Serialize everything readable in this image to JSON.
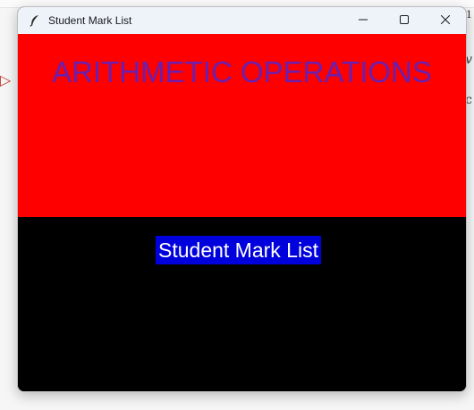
{
  "window": {
    "title": "Student Mark List",
    "icon": "feather-icon",
    "controls": {
      "minimize_icon": "minimize-icon",
      "maximize_icon": "maximize-icon",
      "close_icon": "close-icon"
    }
  },
  "content": {
    "heading": "ARITHMETIC OPERATIONS",
    "sub_label": "Student Mark List"
  },
  "colors": {
    "top_frame_bg": "#ff0000",
    "heading_fg": "#6a1fb0",
    "bottom_frame_bg": "#000000",
    "label_bg": "#0000dd",
    "label_fg": "#ffffff"
  }
}
